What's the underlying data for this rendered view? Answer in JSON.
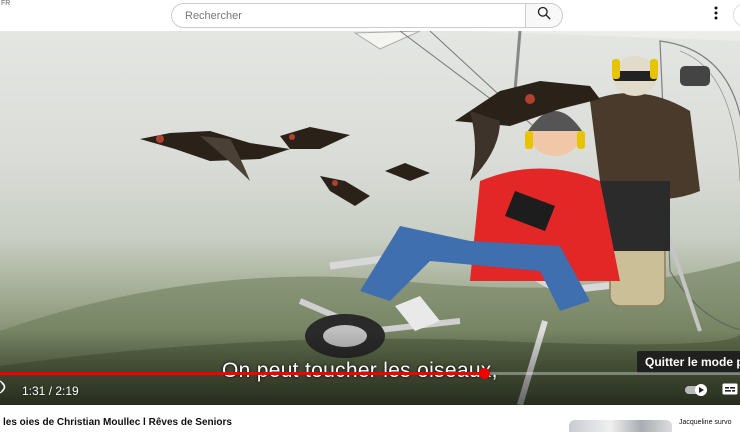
{
  "topbar": {
    "region": "FR",
    "search_placeholder": "Rechercher",
    "search_icon": "search-icon",
    "menu_icon": "more-vert-icon"
  },
  "player": {
    "subtitle": "On peut toucher les oiseaux,",
    "current_time": "1:31",
    "duration": "2:19",
    "time_display": "1:31 / 2:19",
    "progress": 0.655,
    "tooltip": "Quitter le mode plein écran",
    "icons": [
      "volume-icon",
      "autoplay-toggle-icon",
      "subtitles-icon"
    ],
    "accent": "#ff0000"
  },
  "video": {
    "title": "les oies de Christian Moullec l Rêves de Seniors"
  },
  "sidebar": {
    "next_title": "Jacqueline survo"
  }
}
